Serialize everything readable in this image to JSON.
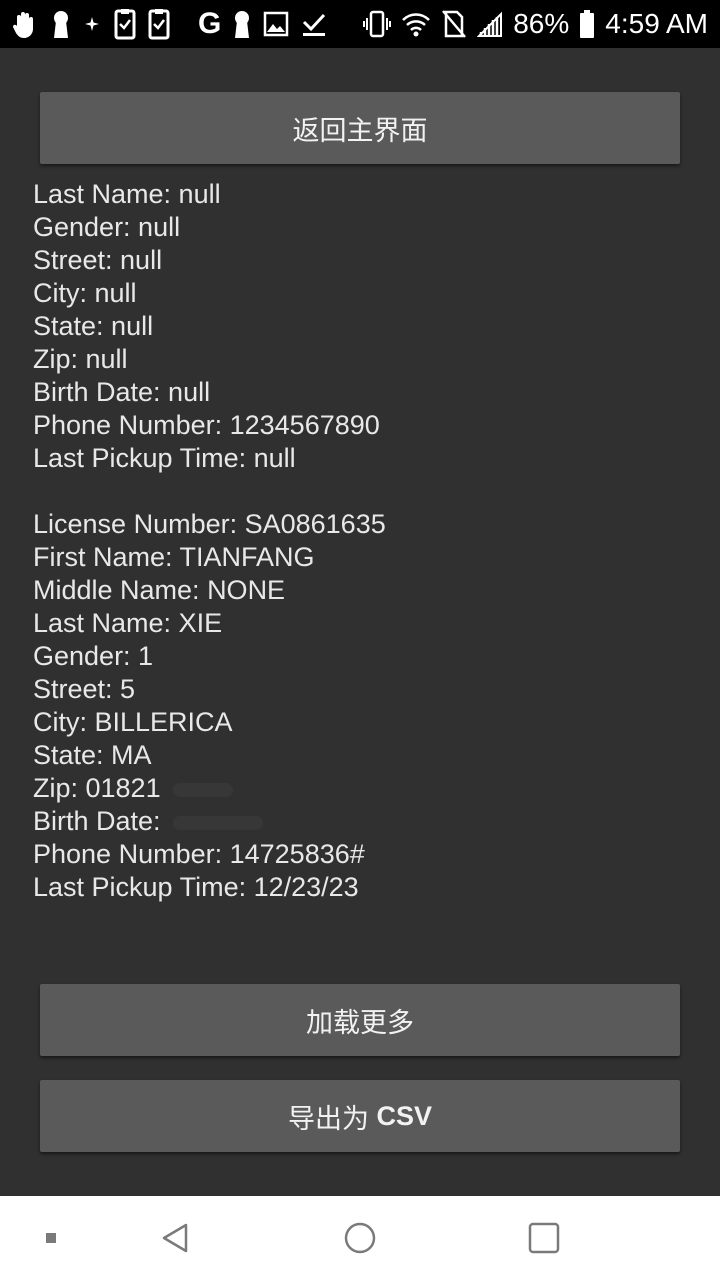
{
  "status_bar": {
    "left_icons": [
      "hand-icon",
      "keyhole-icon",
      "sparkle-icon",
      "clipboard-check-icon",
      "clipboard-check-icon",
      "google-g-icon",
      "keyhole-icon",
      "image-icon",
      "download-done-icon"
    ],
    "google_letter": "G",
    "battery_percent": "86%",
    "time": "4:59 AM",
    "right_icons": [
      "vibrate-icon",
      "wifi-icon",
      "no-sim-icon",
      "signal-icon",
      "battery-icon"
    ]
  },
  "buttons": {
    "back_main": "返回主界面",
    "load_more": "加载更多",
    "export_prefix": "导出为",
    "export_csv": "CSV"
  },
  "records": [
    {
      "last_name": "Last Name: null",
      "gender": "Gender: null",
      "street": "Street: null",
      "city": "City: null",
      "state": "State: null",
      "zip": "Zip: null",
      "birth_date": "Birth Date: null",
      "phone": "Phone Number: 1234567890",
      "last_pickup": "Last Pickup Time: null"
    },
    {
      "license": "License Number: SA0861635",
      "first_name": "First Name: TIANFANG",
      "middle_name": "Middle Name: NONE",
      "last_name": "Last Name: XIE",
      "gender": "Gender: 1",
      "street": "Street: 5",
      "city": "City: BILLERICA",
      "state": "State: MA",
      "zip": "Zip: 01821",
      "birth_date": "Birth Date:",
      "phone": "Phone Number: 14725836#",
      "last_pickup": "Last Pickup Time: 12/23/23"
    }
  ],
  "nav_bar": {
    "buttons": [
      "dot-icon",
      "back-triangle-icon",
      "home-circle-icon",
      "recents-square-icon"
    ]
  },
  "colors": {
    "background": "#303030",
    "button": "#5a5a5b",
    "text": "#e8e8e8",
    "status_bar": "#000000",
    "nav_bar": "#ffffff"
  }
}
